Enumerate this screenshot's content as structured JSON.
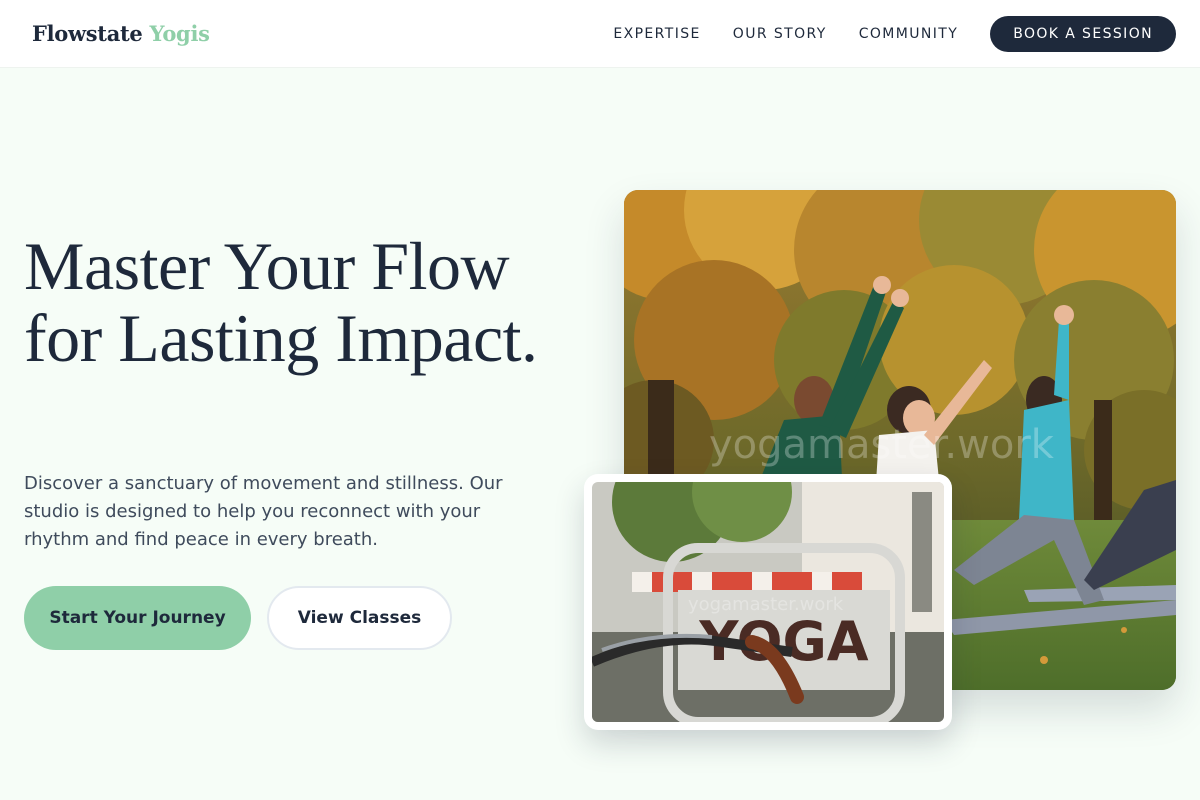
{
  "header": {
    "logo_main": "Flowstate",
    "logo_accent": "Yogis",
    "nav": [
      {
        "label": "EXPERTISE"
      },
      {
        "label": "OUR STORY"
      },
      {
        "label": "COMMUNITY"
      }
    ],
    "cta_label": "BOOK A SESSION"
  },
  "hero": {
    "title": "Master Your Flow for Lasting Impact.",
    "subtitle": "Discover a sanctuary of movement and stillness. Our studio is designed to help you reconnect with your rhythm and find peace in every breath.",
    "primary_button": "Start Your Journey",
    "secondary_button": "View Classes"
  },
  "images": {
    "main_photo": {
      "watermark": "yogamaster.work"
    },
    "inset_photo": {
      "sign_text": "YOGA",
      "watermark": "yogamaster.work"
    }
  },
  "colors": {
    "accent_green": "#8fcfa8",
    "navy": "#1e293b",
    "page_bg": "#f6fdf7"
  }
}
